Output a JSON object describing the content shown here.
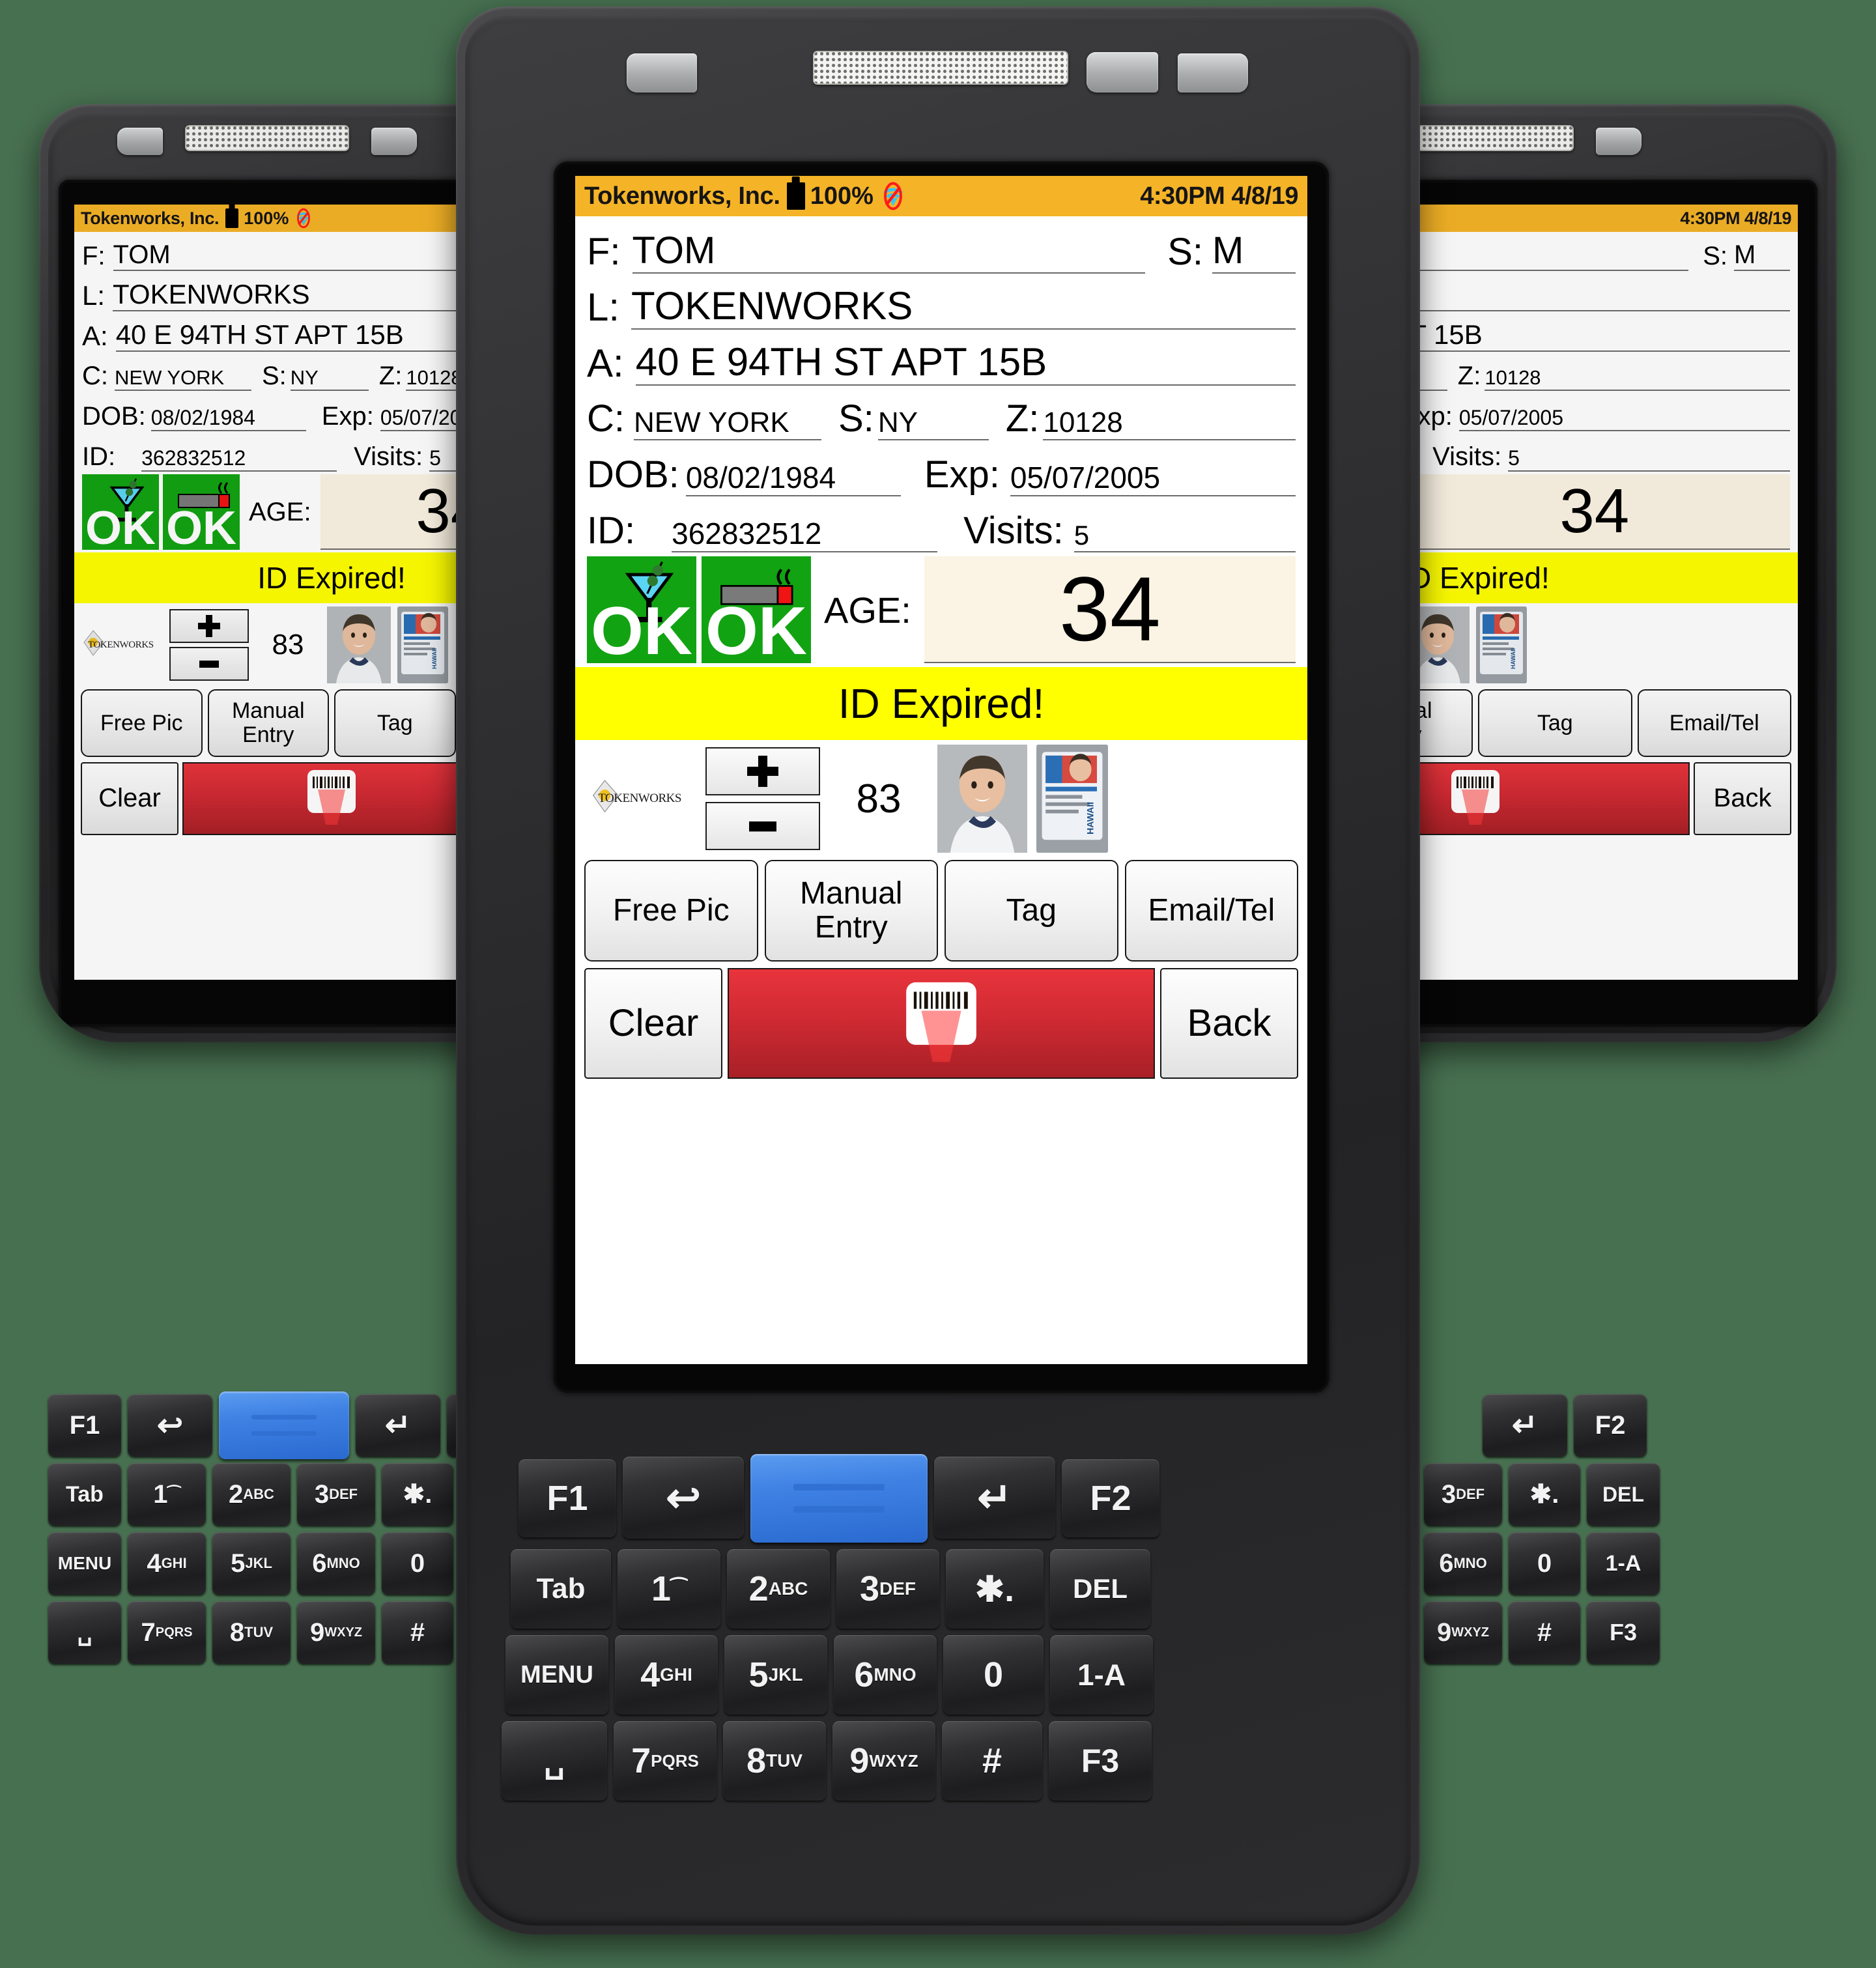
{
  "background_color": "#477050",
  "app": {
    "status_bar": {
      "company": "Tokenworks, Inc.",
      "battery_percent": "100%",
      "battery_icon": "battery-full-icon",
      "wifi_icon": "wifi-disabled-icon",
      "time_date": "4:30PM 4/8/19",
      "bar_color": "#f5b327"
    },
    "fields": {
      "first_label": "F:",
      "first_value": "TOM",
      "sex_label": "S:",
      "sex_value": "M",
      "last_label": "L:",
      "last_value": "TOKENWORKS",
      "address_label": "A:",
      "address_value": "40 E 94TH ST APT 15B",
      "city_label": "C:",
      "city_value": "NEW YORK",
      "state_label": "S:",
      "state_value": "NY",
      "zip_label": "Z:",
      "zip_value": "10128",
      "dob_label": "DOB:",
      "dob_value": "08/02/1984",
      "exp_label": "Exp:",
      "exp_value": "05/07/2005",
      "id_label": "ID:",
      "id_value": "362832512",
      "visits_label": "Visits:",
      "visits_value": "5"
    },
    "badges": {
      "alcohol_ok_text": "OK",
      "alcohol_icon": "martini-glass-icon",
      "tobacco_ok_text": "OK",
      "tobacco_icon": "cigarette-icon",
      "ok_color": "#12a312",
      "age_label": "AGE:",
      "age_value": "34",
      "age_box_color": "#fbf3e3"
    },
    "warning": {
      "text": "ID Expired!",
      "color": "#ffff00"
    },
    "counter": {
      "logo_text": "TOKENWORKS",
      "plus_label": "+",
      "minus_label": "−",
      "count_value": "83",
      "portrait_icon": "person-portrait-image",
      "id_card_icon": "hawaii-id-card-image"
    },
    "action_buttons": [
      {
        "label": "Free Pic",
        "name": "free-pic-button"
      },
      {
        "label": "Manual Entry",
        "line1": "Manual",
        "line2": "Entry",
        "name": "manual-entry-button"
      },
      {
        "label": "Tag",
        "name": "tag-button"
      },
      {
        "label": "Email/Tel",
        "name": "email-tel-button"
      }
    ],
    "bottom_buttons": {
      "clear_label": "Clear",
      "scan_icon": "barcode-scan-icon",
      "scan_color": "#d02a33",
      "back_label": "Back"
    }
  },
  "keypad": {
    "row1": [
      {
        "label": "F1",
        "name": "key-f1"
      },
      {
        "label": "↩",
        "name": "key-back-arrow"
      },
      {
        "label": "",
        "name": "key-scan",
        "blue": true
      },
      {
        "label": "↵",
        "name": "key-enter"
      },
      {
        "label": "F2",
        "name": "key-f2"
      }
    ],
    "row2": [
      {
        "dig": "Tab",
        "sub": "",
        "name": "key-tab"
      },
      {
        "dig": "1",
        "sub": "⁀",
        "name": "key-1"
      },
      {
        "dig": "2",
        "sub": "ABC",
        "name": "key-2"
      },
      {
        "dig": "3",
        "sub": "DEF",
        "name": "key-3"
      },
      {
        "dig": "✱",
        "sub": ".",
        "name": "key-star"
      },
      {
        "dig": "DEL",
        "sub": "",
        "name": "key-del"
      }
    ],
    "row3": [
      {
        "dig": "MENU",
        "sub": "",
        "name": "key-menu"
      },
      {
        "dig": "4",
        "sub": "GHI",
        "name": "key-4"
      },
      {
        "dig": "5",
        "sub": "JKL",
        "name": "key-5"
      },
      {
        "dig": "6",
        "sub": "MNO",
        "name": "key-6"
      },
      {
        "dig": "0",
        "sub": "",
        "name": "key-0"
      },
      {
        "dig": "1-A",
        "sub": "",
        "name": "key-1a"
      }
    ],
    "row4": [
      {
        "dig": "␣",
        "sub": "",
        "name": "key-space"
      },
      {
        "dig": "7",
        "sub": "PQRS",
        "name": "key-7"
      },
      {
        "dig": "8",
        "sub": "TUV",
        "name": "key-8"
      },
      {
        "dig": "9",
        "sub": "WXYZ",
        "name": "key-9"
      },
      {
        "dig": "#",
        "sub": "",
        "name": "key-hash"
      },
      {
        "dig": "F3",
        "sub": "",
        "name": "key-f3"
      }
    ]
  }
}
